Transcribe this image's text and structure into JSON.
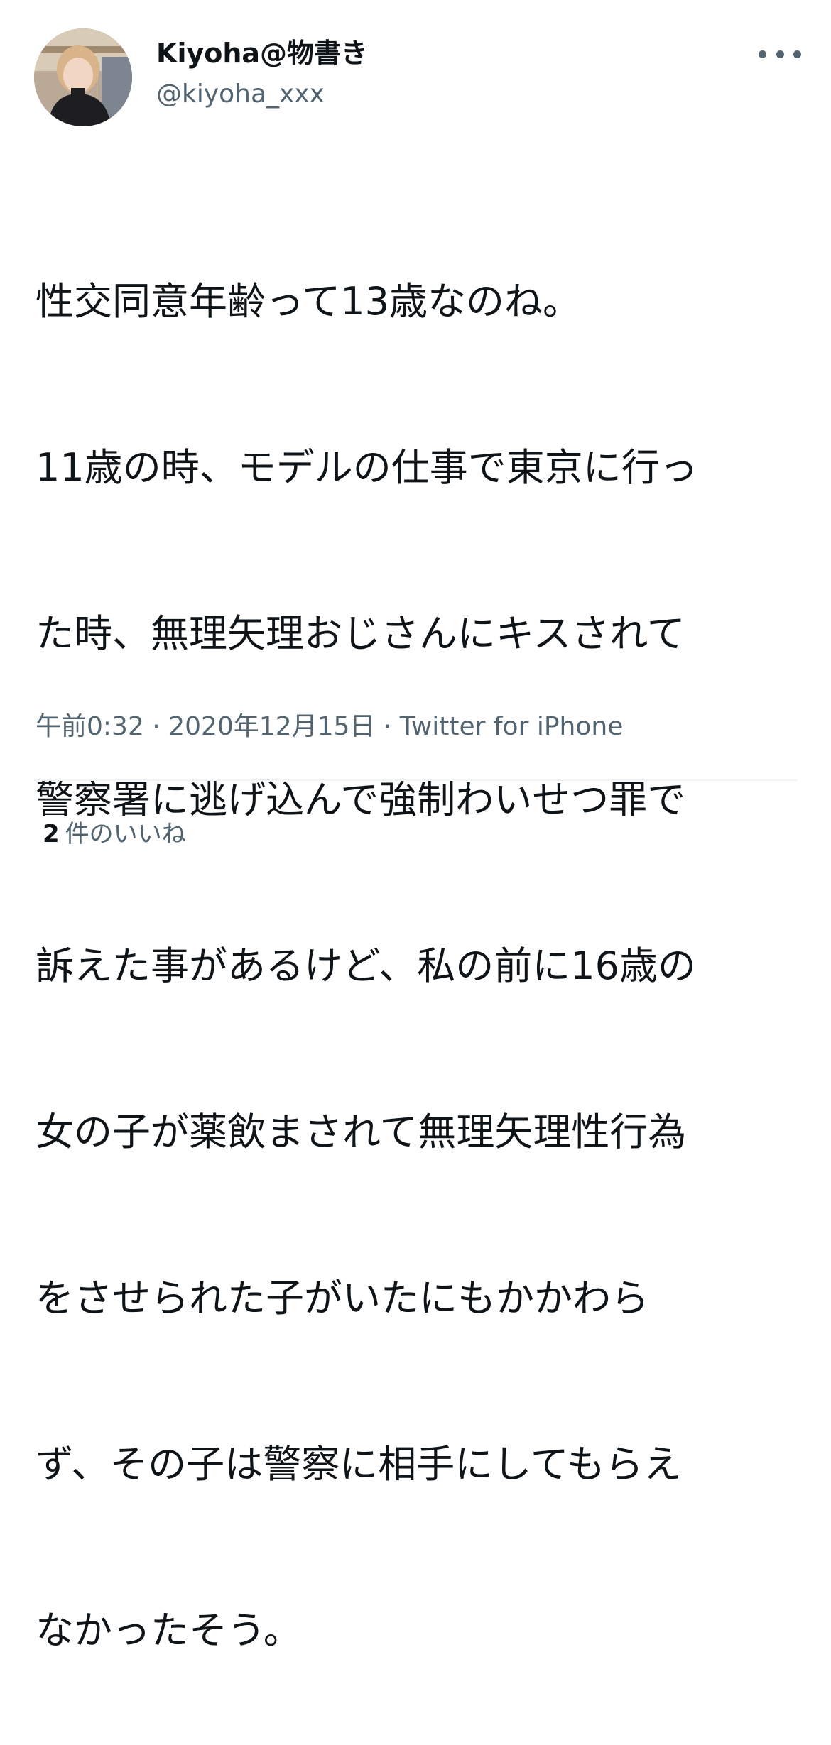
{
  "author": {
    "display_name": "Kiyoha@物書き",
    "handle": "@kiyoha_xxx",
    "avatar_icon": "profile-photo"
  },
  "tweet": {
    "lines": [
      "性交同意年齢って13歳なのね。",
      "11歳の時、モデルの仕事で東京に行っ",
      "た時、無理矢理おじさんにキスされて",
      "警察署に逃げ込んで強制わいせつ罪で",
      "訴えた事があるけど、私の前に16歳の",
      "女の子が薬飲まされて無理矢理性行為",
      "をさせられた子がいたにもかかわら",
      "ず、その子は警察に相手にしてもらえ",
      "なかったそう。"
    ]
  },
  "meta": {
    "time": "午前0:32",
    "separator1": " · ",
    "date": "2020年12月15日",
    "separator2": " · ",
    "source": "Twitter for iPhone"
  },
  "stats": {
    "likes_count": "2",
    "likes_label": "件のいいね"
  },
  "icons": {
    "more": "more-horizontal-icon"
  },
  "colors": {
    "text_primary": "#0f1419",
    "text_secondary": "#536471",
    "divider": "#eff3f4"
  }
}
